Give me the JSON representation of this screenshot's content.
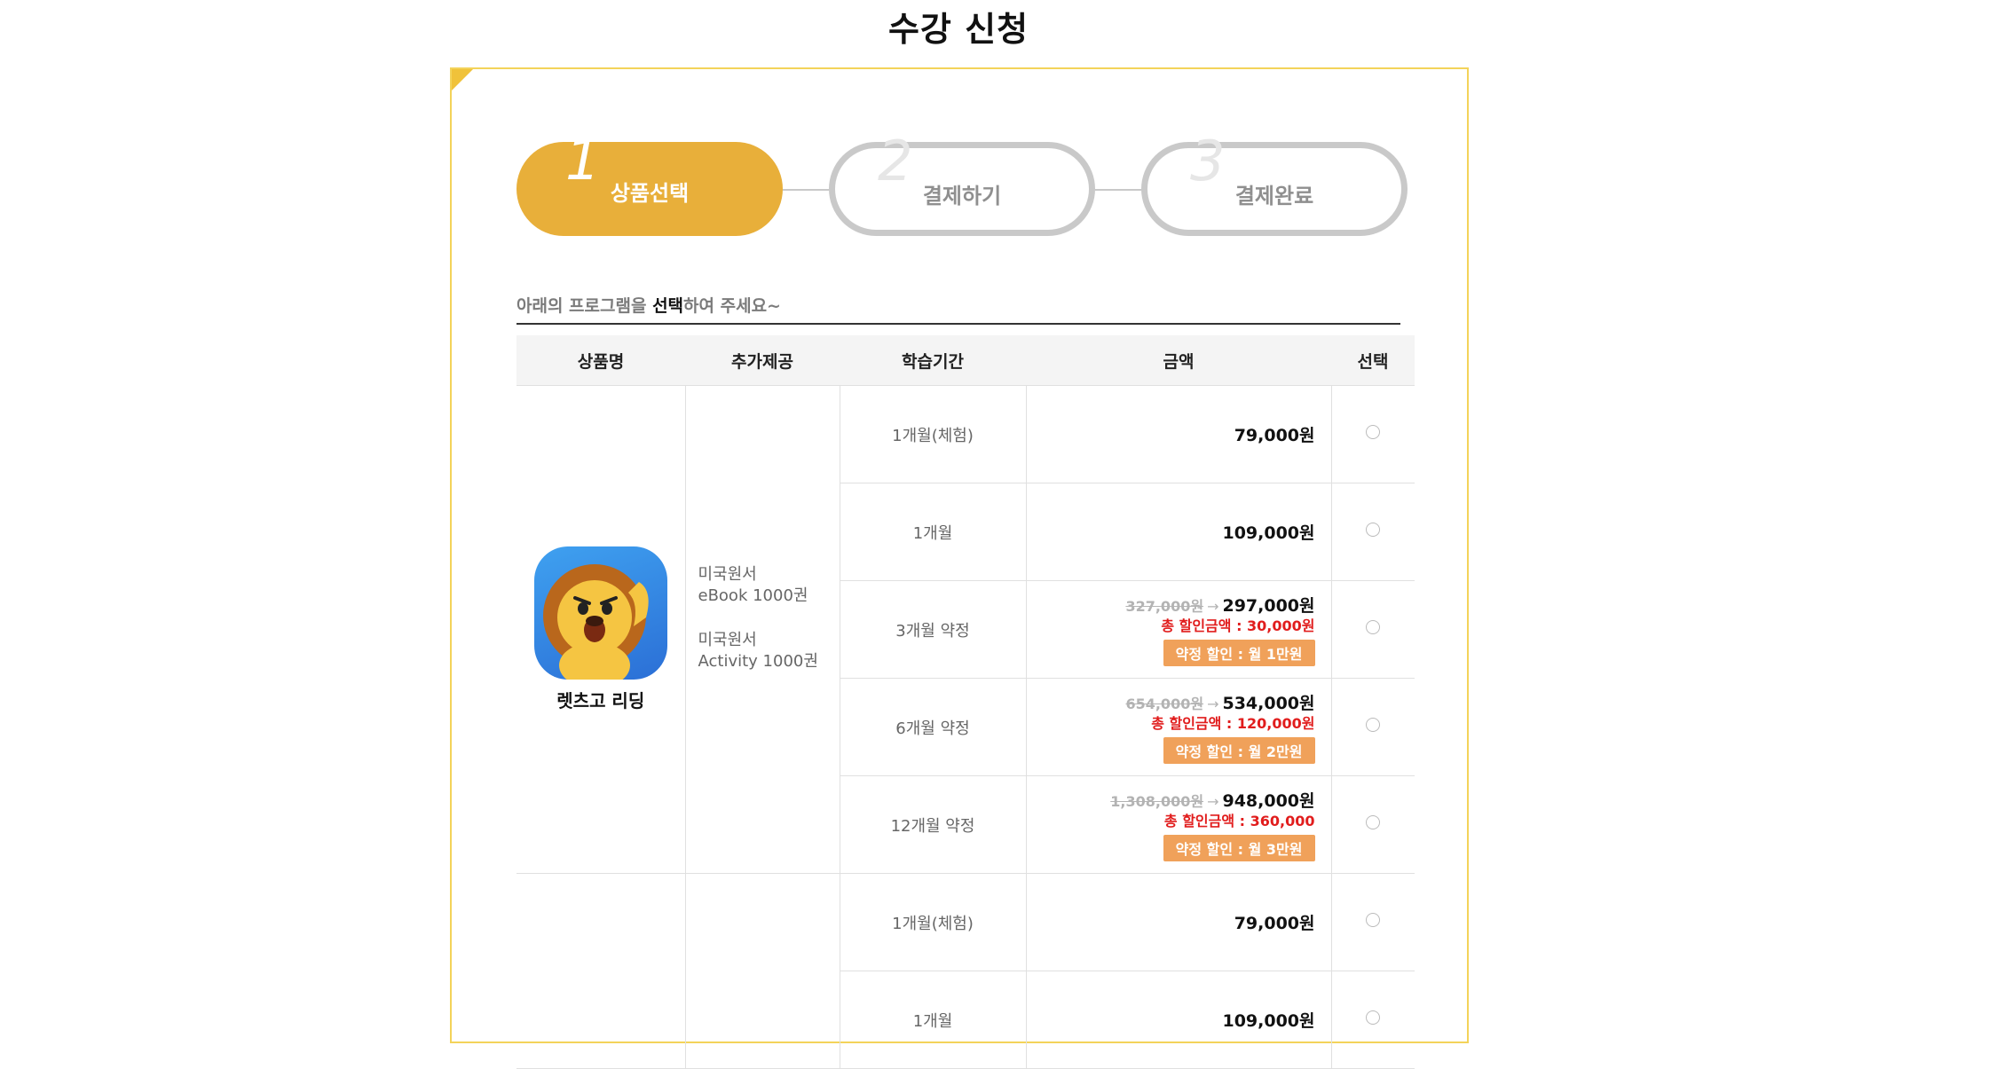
{
  "page": {
    "title": "수강 신청"
  },
  "steps": [
    {
      "num": "1",
      "label": "상품선택",
      "active": true
    },
    {
      "num": "2",
      "label": "결제하기",
      "active": false
    },
    {
      "num": "3",
      "label": "결제완료",
      "active": false
    }
  ],
  "instruction": {
    "prefix": "아래의 프로그램을 ",
    "highlight": "선택",
    "suffix": "하여 주세요~"
  },
  "table": {
    "headers": [
      "상품명",
      "추가제공",
      "학습기간",
      "금액",
      "선택"
    ],
    "product": {
      "name": "렛츠고 리딩",
      "logo_icon": "lion-mascot-icon",
      "extras": [
        {
          "line1": "미국원서",
          "line2": "eBook 1000권"
        },
        {
          "line1": "미국원서",
          "line2": "Activity 1000권"
        }
      ]
    },
    "rows": [
      {
        "period": "1개월(체험)",
        "price": "79,000원"
      },
      {
        "period": "1개월",
        "price": "109,000원"
      },
      {
        "period": "3개월 약정",
        "old_price": "327,000원",
        "price": "297,000원",
        "discount_total": "총 할인금액 : 30,000원",
        "badge": "약정 할인 : 월 1만원"
      },
      {
        "period": "6개월 약정",
        "old_price": "654,000원",
        "price": "534,000원",
        "discount_total": "총 할인금액 : 120,000원",
        "badge": "약정 할인 : 월 2만원"
      },
      {
        "period": "12개월 약정",
        "old_price": "1,308,000원",
        "price": "948,000원",
        "discount_total": "총 할인금액 : 360,000",
        "badge": "약정 할인 : 월 3만원"
      }
    ],
    "rows2": [
      {
        "period": "1개월(체험)",
        "price": "79,000원"
      },
      {
        "period": "1개월",
        "price": "109,000원"
      }
    ]
  },
  "colors": {
    "accent": "#e8af3a",
    "frame": "#f3d35a",
    "discount": "#e11d1d",
    "badge": "#f0a15a"
  }
}
